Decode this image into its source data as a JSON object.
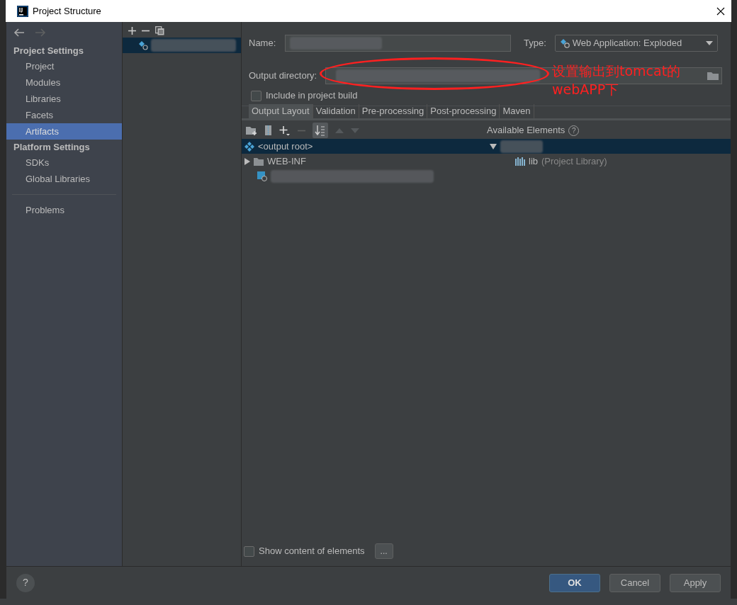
{
  "window": {
    "title": "Project Structure"
  },
  "sidebar": {
    "sections": [
      {
        "title": "Project Settings",
        "items": [
          {
            "label": "Project",
            "selected": false
          },
          {
            "label": "Modules",
            "selected": false
          },
          {
            "label": "Libraries",
            "selected": false
          },
          {
            "label": "Facets",
            "selected": false
          },
          {
            "label": "Artifacts",
            "selected": true
          }
        ]
      },
      {
        "title": "Platform Settings",
        "items": [
          {
            "label": "SDKs",
            "selected": false
          },
          {
            "label": "Global Libraries",
            "selected": false
          }
        ]
      }
    ],
    "extra_items": [
      {
        "label": "Problems",
        "selected": false
      }
    ]
  },
  "artifacts": [
    {
      "selected": true
    }
  ],
  "form": {
    "name_label": "Name:",
    "type_label": "Type:",
    "type_value": "Web Application: Exploded",
    "output_label": "Output directory:",
    "include_label": "Include in project build",
    "include_checked": false
  },
  "annotation": {
    "text": "设置输出到tomcat的webAPP下",
    "color": "#ff2020"
  },
  "tabs": [
    {
      "label": "Output Layout",
      "selected": true
    },
    {
      "label": "Validation",
      "selected": false
    },
    {
      "label": "Pre-processing",
      "selected": false
    },
    {
      "label": "Post-processing",
      "selected": false
    },
    {
      "label": "Maven",
      "selected": false
    }
  ],
  "layout_tree": [
    {
      "kind": "root",
      "label": "<output root>",
      "selected": true
    },
    {
      "kind": "folder",
      "label": "WEB-INF",
      "selected": false
    },
    {
      "kind": "hidden",
      "selected": false
    }
  ],
  "available": {
    "title": "Available Elements",
    "help": "?",
    "items": [
      {
        "kind": "hidden",
        "selected": true
      },
      {
        "kind": "library",
        "label": "lib",
        "detail": "(Project Library)",
        "selected": false
      }
    ]
  },
  "show_content": {
    "label": "Show content of elements",
    "checked": false,
    "more": "..."
  },
  "buttons": [
    {
      "label": "OK",
      "primary": true
    },
    {
      "label": "Cancel",
      "primary": false
    },
    {
      "label": "Apply",
      "primary": false
    }
  ],
  "help_button": "?"
}
